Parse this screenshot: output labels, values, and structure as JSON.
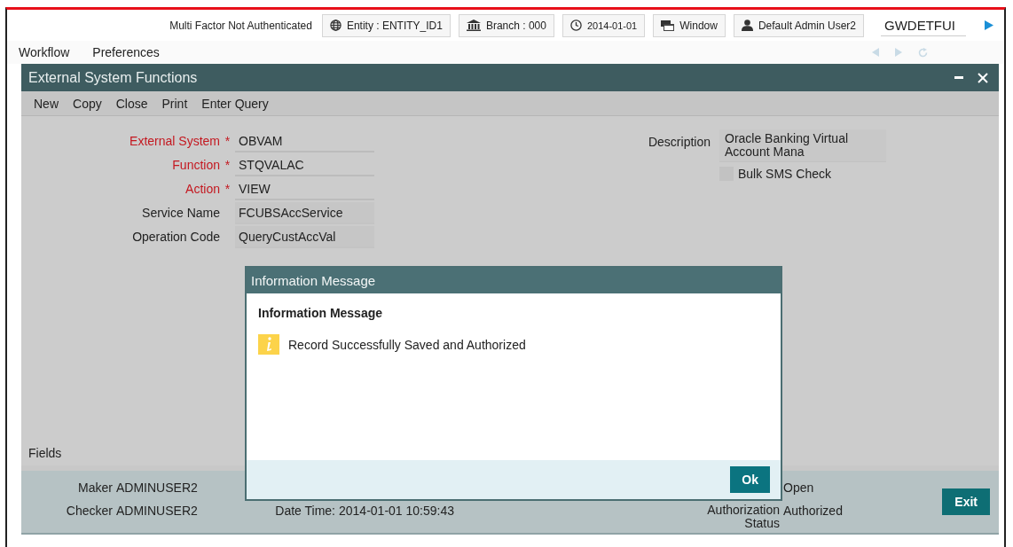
{
  "header": {
    "status": "Multi Factor Not Authenticated",
    "chips": [
      {
        "kind": "globe",
        "label": "Entity : ENTITY_ID1"
      },
      {
        "kind": "bank",
        "label": "Branch : 000"
      },
      {
        "kind": "clock",
        "label": "2014-01-01"
      },
      {
        "kind": "windows",
        "label": "Window"
      },
      {
        "kind": "user",
        "label": "Default Admin User2"
      }
    ],
    "search_value": "GWDETFUI"
  },
  "menu": [
    "Workflow",
    "Preferences"
  ],
  "window": {
    "title": "External System Functions",
    "toolbar": [
      "New",
      "Copy",
      "Close",
      "Print",
      "Enter Query"
    ],
    "required_symbol": "*",
    "fields": [
      {
        "label": "External System",
        "required": true,
        "value": "OBVAM"
      },
      {
        "label": "Function",
        "required": true,
        "value": "STQVALAC"
      },
      {
        "label": "Action",
        "required": true,
        "value": "VIEW"
      },
      {
        "label": "Service Name",
        "required": false,
        "value": "FCUBSAccService"
      },
      {
        "label": "Operation Code",
        "required": false,
        "value": "QueryCustAccVal"
      }
    ],
    "description": {
      "label": "Description",
      "value": "Oracle Banking Virtual Account Mana"
    },
    "bulk_sms": {
      "label": "Bulk SMS Check",
      "checked": false
    },
    "section": "Fields",
    "footer": {
      "maker": {
        "label": "Maker",
        "value": "ADMINUSER2"
      },
      "checker": {
        "label": "Checker",
        "value": "ADMINUSER2"
      },
      "date_time": {
        "label": "Date Time:",
        "value": "2014-01-01 10:59:43"
      },
      "record_status": {
        "value": "Open"
      },
      "authorization": {
        "label": "Authorization Status",
        "value": "Authorized"
      },
      "exit": "Exit"
    }
  },
  "dialog": {
    "title": "Information Message",
    "heading": "Information Message",
    "message": "Record Successfully Saved and Authorized",
    "button": "Ok"
  }
}
